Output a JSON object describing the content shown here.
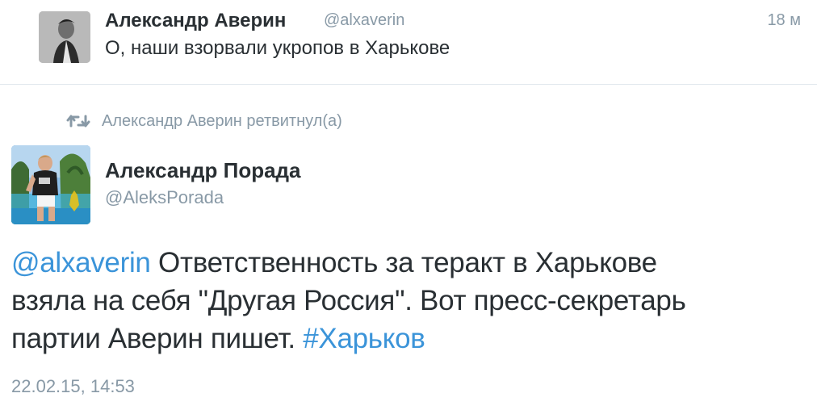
{
  "tweet": {
    "author_name": "Александр Аверин",
    "handle": "@alxaverin",
    "time": "18 м",
    "text": "О, наши взорвали укропов в Харькове"
  },
  "retweet": {
    "context": "Александр Аверин ретвитнул(а)",
    "icon": "retweet-icon",
    "author_name": "Александр Порада",
    "handle": "@AleksPorada",
    "mention": "@alxaverin",
    "text_line1": " Ответственность за теракт в Харькове",
    "text_line2": "взяла на себя \"Другая Россия\". Вот пресс-секретарь",
    "text_line3": "партии Аверин пишет. ",
    "hashtag": "#Харьков",
    "date": "22.02.15, 14:53"
  },
  "colors": {
    "link": "#3b94d9",
    "muted": "#8899a6",
    "text": "#292f33",
    "divider": "#e1e8ed"
  }
}
